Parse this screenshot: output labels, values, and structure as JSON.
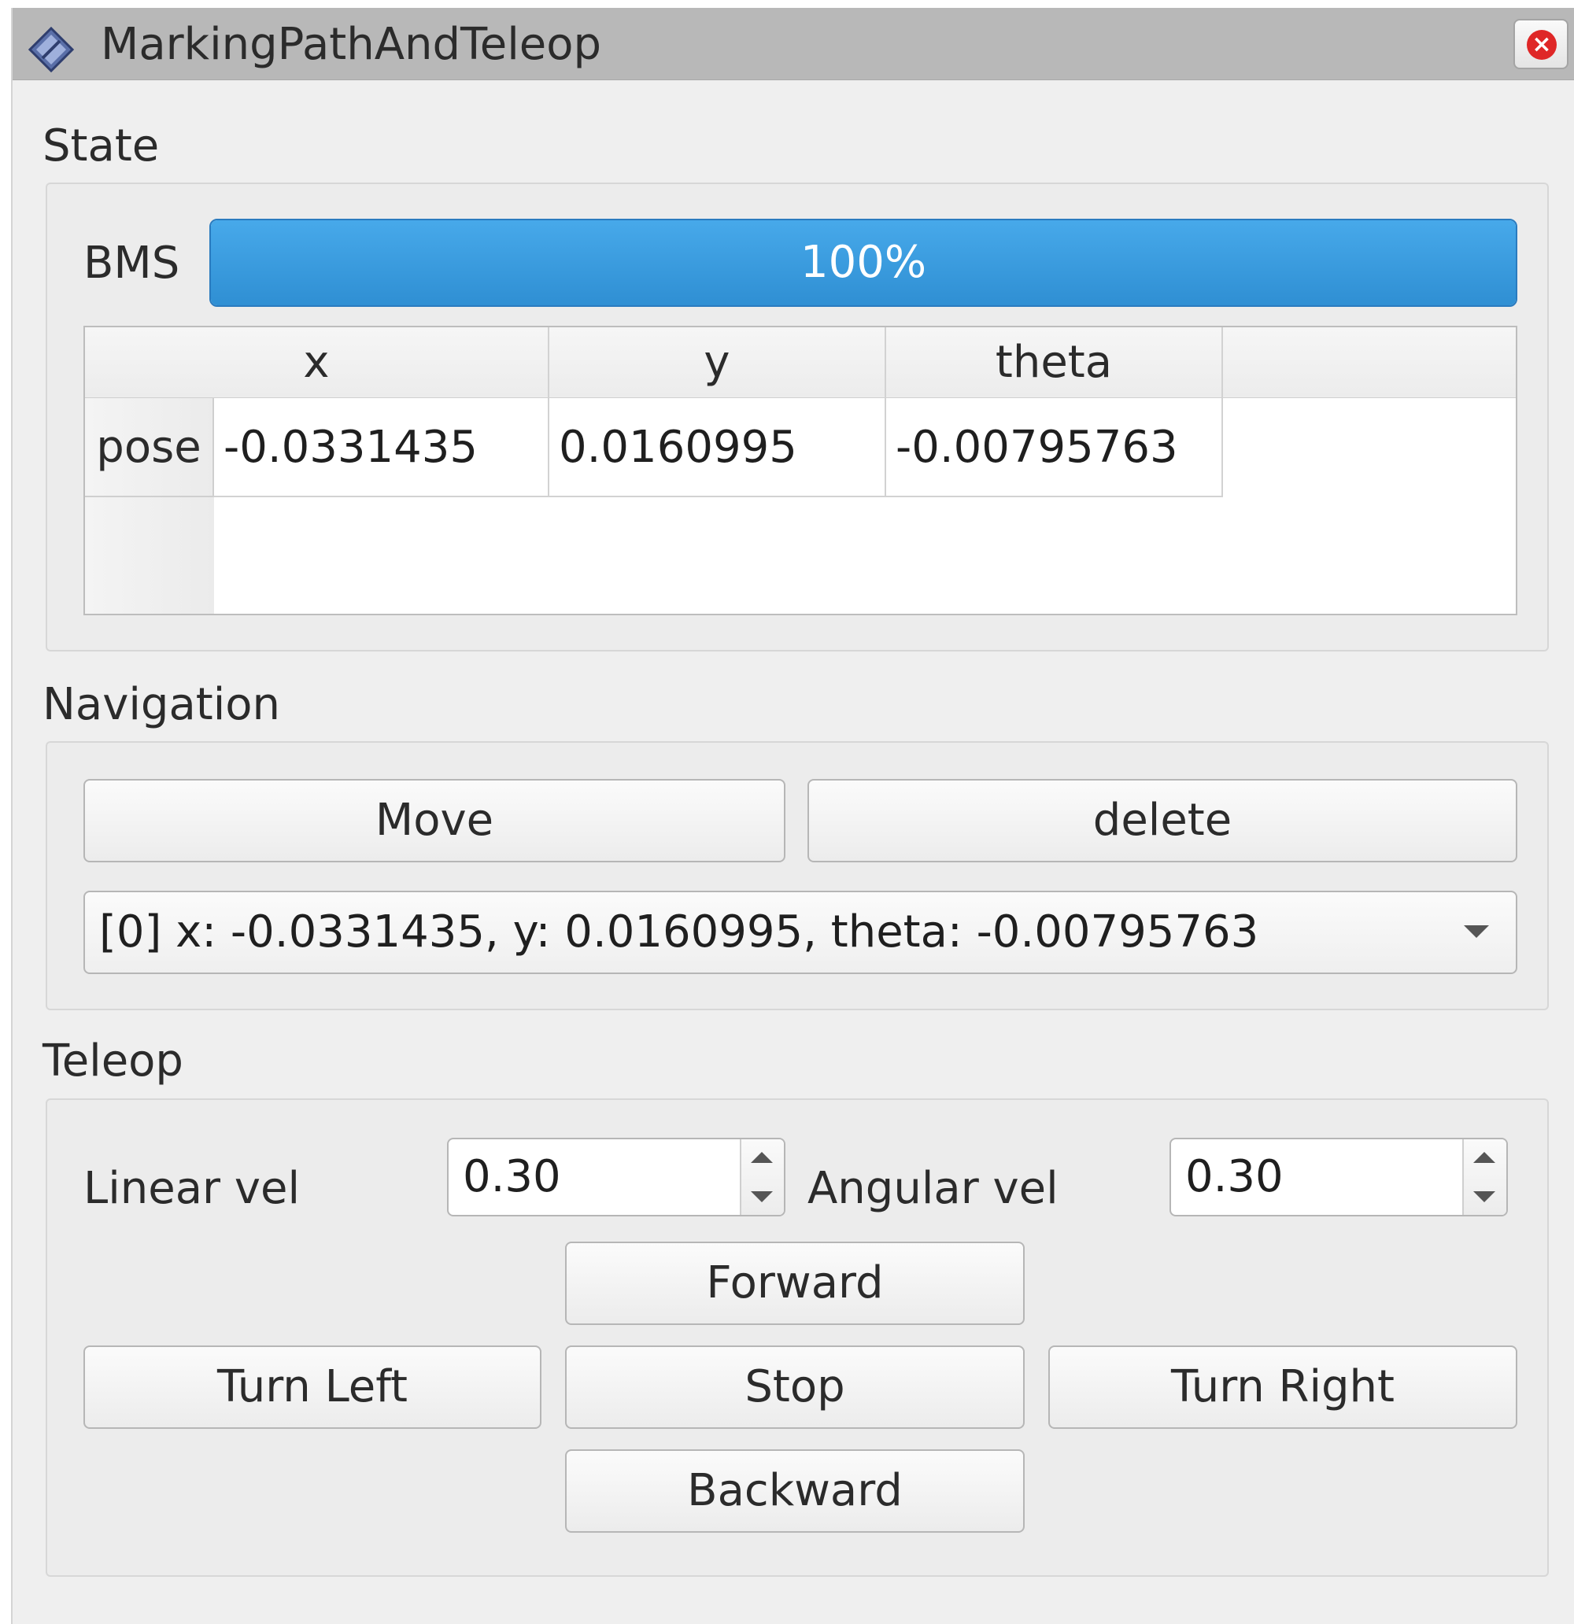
{
  "window": {
    "title": "MarkingPathAndTeleop",
    "title_icon": "diamond-app-icon",
    "close_icon": "close-icon"
  },
  "state": {
    "label": "State",
    "bms": {
      "label": "BMS",
      "percent": 100,
      "text": "100%",
      "color": "#3a9de0"
    },
    "table": {
      "columns": [
        "x",
        "y",
        "theta"
      ],
      "rows": [
        {
          "header": "pose",
          "values": [
            "-0.0331435",
            "0.0160995",
            "-0.00795763"
          ]
        }
      ]
    }
  },
  "navigation": {
    "label": "Navigation",
    "move_label": "Move",
    "delete_label": "delete",
    "waypoint_selected": "[0] x: -0.0331435, y: 0.0160995, theta: -0.00795763"
  },
  "teleop": {
    "label": "Teleop",
    "linear_label": "Linear vel",
    "linear_value": "0.30",
    "angular_label": "Angular vel",
    "angular_value": "0.30",
    "forward_label": "Forward",
    "turn_left_label": "Turn Left",
    "stop_label": "Stop",
    "turn_right_label": "Turn Right",
    "backward_label": "Backward"
  }
}
